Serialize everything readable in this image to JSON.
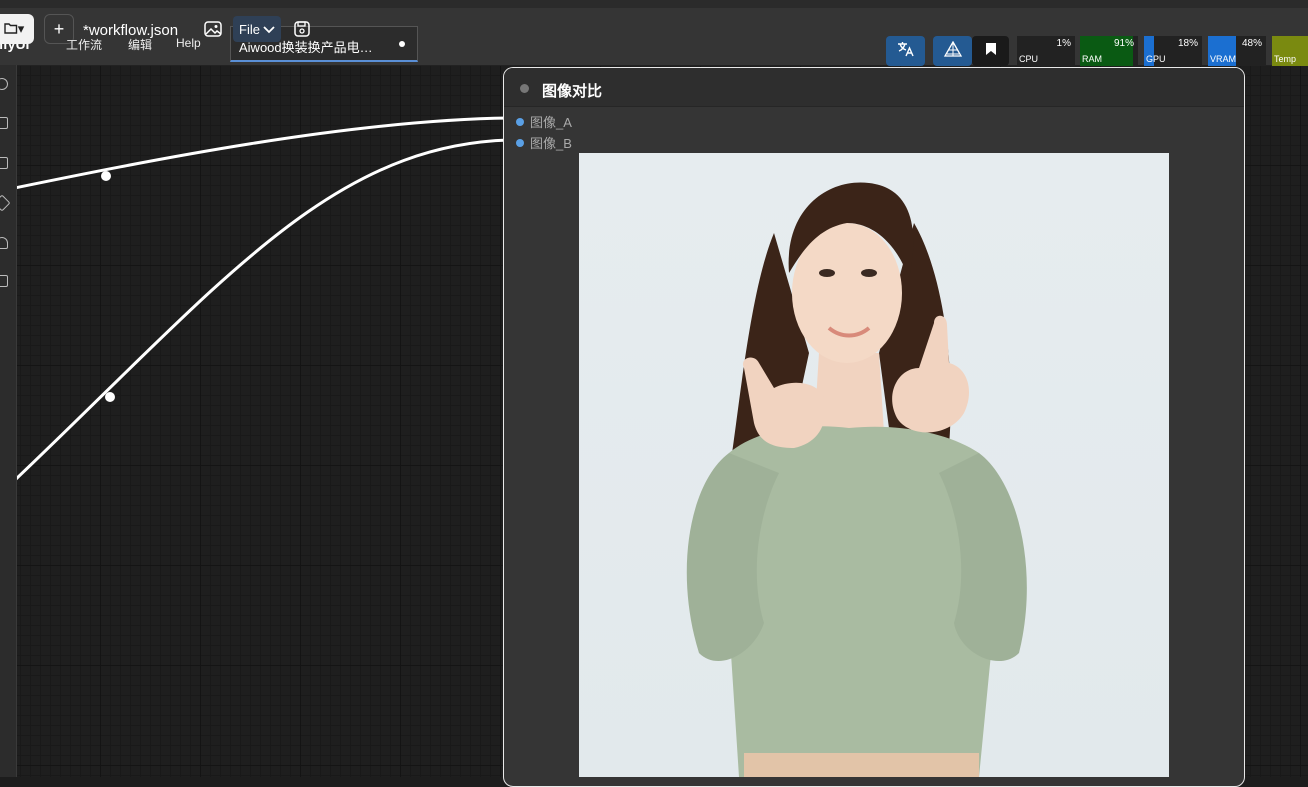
{
  "app": {
    "logo_text": "omfyUI"
  },
  "toolbar": {
    "folder_caret": "▾",
    "new_tab": "+",
    "workflow_file": "*workflow.json",
    "menu_workflow": "工作流",
    "menu_edit": "编辑",
    "menu_help": "Help",
    "file_menu": "File"
  },
  "tab": {
    "label": "Aiwood换装换产品电…"
  },
  "monitors": [
    {
      "name": "CPU",
      "value": "1%",
      "fraction": 0.01,
      "color": "#222222"
    },
    {
      "name": "RAM",
      "value": "91%",
      "fraction": 0.91,
      "color": "#0a5a13"
    },
    {
      "name": "GPU",
      "value": "18%",
      "fraction": 0.18,
      "color": "#1b6fd1"
    },
    {
      "name": "VRAM",
      "value": "48%",
      "fraction": 0.48,
      "color": "#1b6fd1"
    },
    {
      "name": "Temp",
      "value": "",
      "fraction": 1.0,
      "color": "#7a8a10"
    }
  ],
  "node": {
    "title": "图像对比",
    "inputs": [
      "图像_A",
      "图像_B"
    ]
  },
  "colors": {
    "accent": "#2f5f9c",
    "slot": "#5aa0e6",
    "link": "#ffffff"
  }
}
